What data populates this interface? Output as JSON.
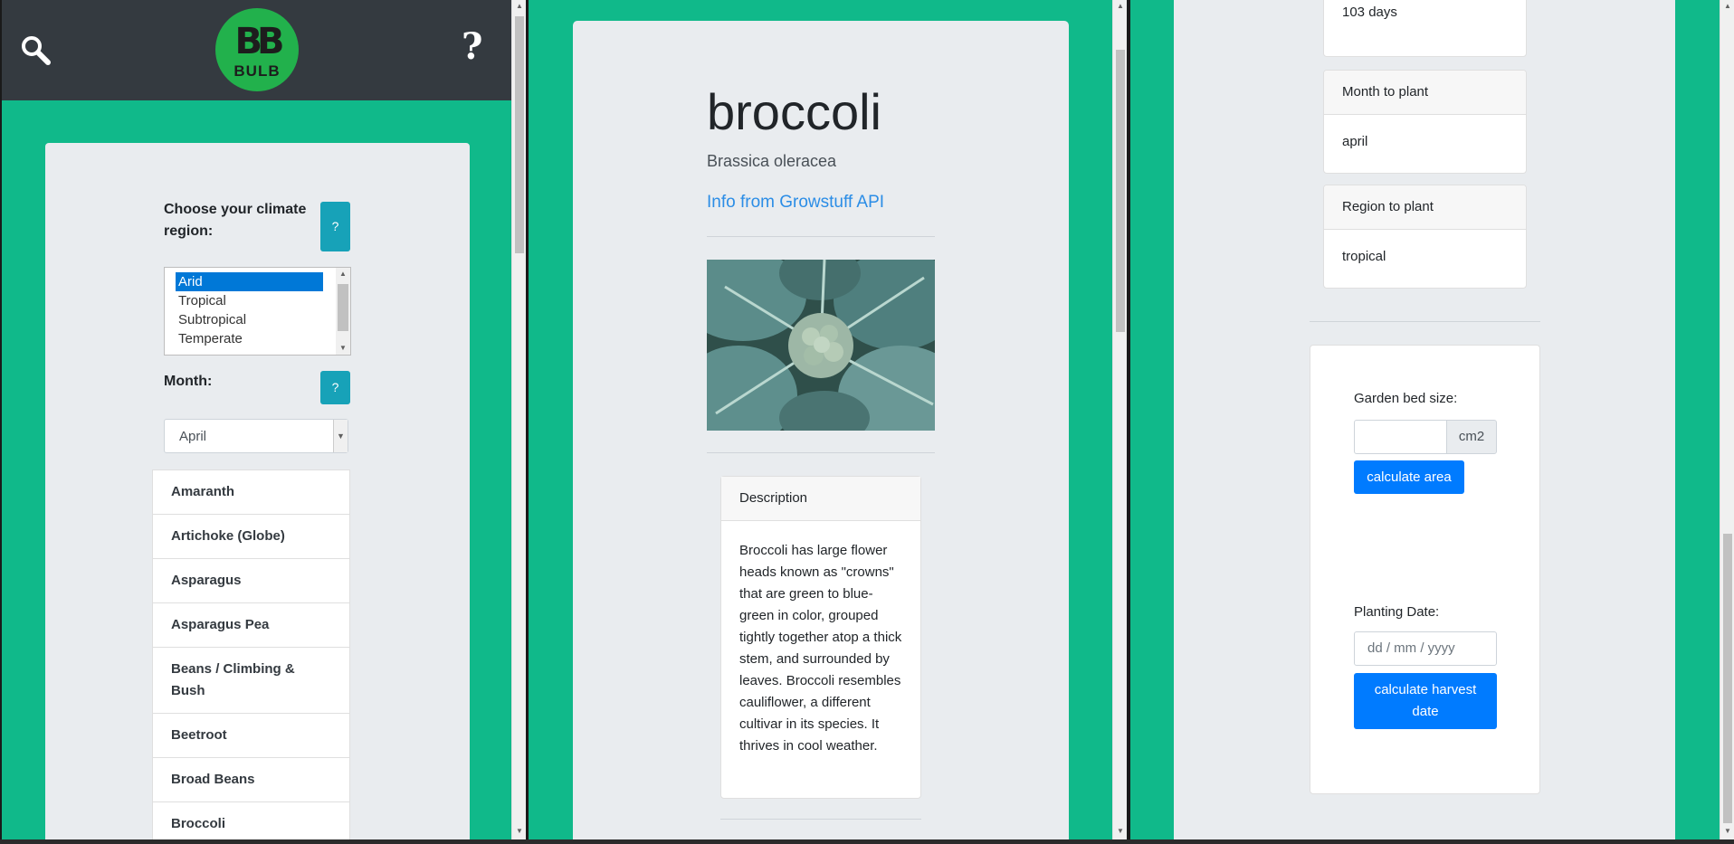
{
  "pane1": {
    "logo_text": "BULB",
    "logo_mark": "BB",
    "help_label": "?",
    "climate_label": "Choose your climate region:",
    "climate_help": "?",
    "climate_options": [
      "Arid",
      "Tropical",
      "Subtropical",
      "Temperate"
    ],
    "climate_selected": "Arid",
    "month_label": "Month:",
    "month_help": "?",
    "month_selected": "April",
    "plants": [
      "Amaranth",
      "Artichoke (Globe)",
      "Asparagus",
      "Asparagus Pea",
      "Beans / Climbing & Bush",
      "Beetroot",
      "Broad Beans",
      "Broccoli"
    ]
  },
  "pane2": {
    "title": "broccoli",
    "scientific_name": "Brassica oleracea",
    "source_link": "Info from Growstuff API",
    "description_header": "Description",
    "description_body": "Broccoli has large flower heads known as \"crowns\" that are green to blue-green in color, grouped tightly together atop a thick stem, and surrounded by leaves. Broccoli resembles cauliflower, a different cultivar in its species. It thrives in cool weather."
  },
  "pane3": {
    "days_value": "103 days",
    "month_header": "Month to plant",
    "month_value": "april",
    "region_header": "Region to plant",
    "region_value": "tropical",
    "bed_label": "Garden bed size:",
    "bed_unit": "cm2",
    "bed_value": "",
    "area_button": "calculate area",
    "planting_label": "Planting Date:",
    "date_placeholder": "dd / mm / yyyy",
    "harvest_button": "calculate harvest date"
  },
  "colors": {
    "background_green": "#10b98a",
    "navbar": "#343a40",
    "card": "#e9ecef",
    "help_button": "#17a2b8",
    "primary_button": "#007bff",
    "link": "#2b8de6",
    "logo_green": "#22b14c"
  },
  "icons": [
    "search-icon",
    "help-icon",
    "logo-icon",
    "chevron-down-icon",
    "chevron-up-icon"
  ]
}
